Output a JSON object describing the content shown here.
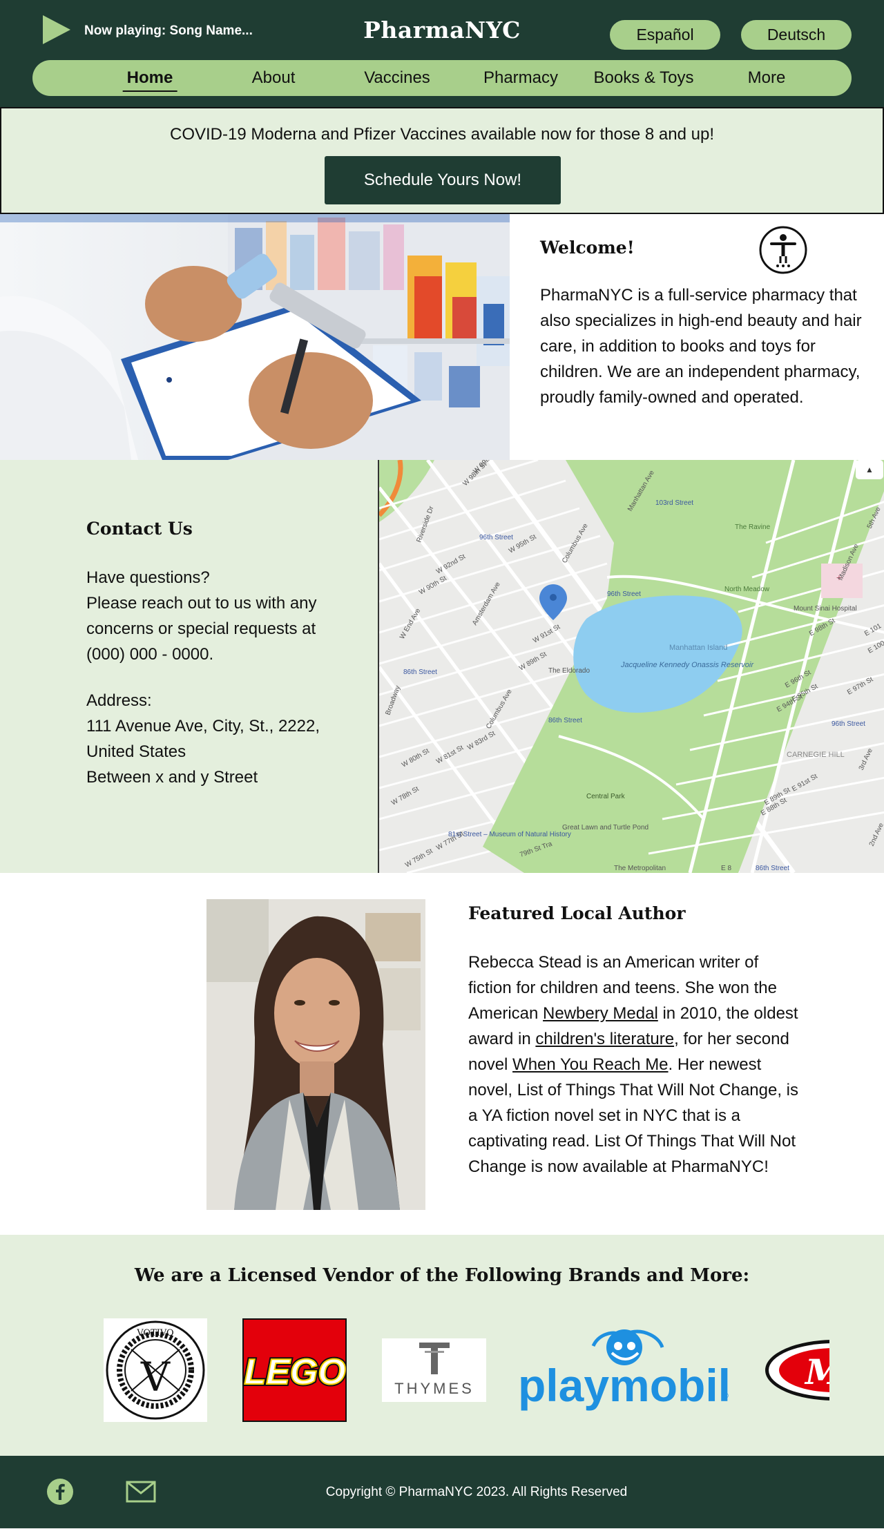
{
  "header": {
    "now_playing": "Now playing: Song Name...",
    "brand": "PharmaNYC",
    "languages": [
      "Español",
      "Deutsch"
    ],
    "nav": [
      "Home",
      "About",
      "Vaccines",
      "Pharmacy",
      "Books & Toys",
      "More"
    ],
    "active_nav": "Home"
  },
  "banner": {
    "text": "COVID-19 Moderna and Pfizer Vaccines available now for those 8 and up!",
    "button": "Schedule Yours Now!"
  },
  "welcome": {
    "title": "Welcome!",
    "text": "PharmaNYC is a full-service pharmacy that also specializes in high-end beauty and hair care, in addition to books and toys for children. We are an independent pharmacy, proudly family-owned and operated."
  },
  "contact": {
    "title": "Contact Us",
    "question": "Have questions?",
    "text": "Please reach out to us with any concerns or special requests at (000) 000 - 0000.",
    "address_label": "Address:",
    "address_line": "111 Avenue Ave, City, St., 2222, United States",
    "address_cross": "Between x and y Street"
  },
  "map": {
    "labels": {
      "w99": "W 99th St",
      "w98": "W 98th St",
      "manhattan_ave": "Manhattan Ave",
      "st103": "103rd Street",
      "fifth_ave": "5th Ave",
      "the_ravine": "The Ravine",
      "riverside": "Riverside Dr",
      "st96a": "96th Street",
      "w95": "W 95th St",
      "columbus_ave": "Columbus Ave",
      "w92": "W 92nd St",
      "w90": "W 90th St",
      "amsterdam": "Amsterdam Ave",
      "st96b": "96th Street",
      "north_meadow": "North Meadow",
      "madison": "Madison Ave",
      "mount_sinai": "Mount Sinai Hospital",
      "e98": "E 98th St",
      "e101": "E 101",
      "e100": "E 100",
      "w_end": "W End Ave",
      "w91": "W 91st St",
      "manhattan_island": "Manhattan Island",
      "st86a": "86th Street",
      "w89": "W 89th St",
      "eldorado": "The Eldorado",
      "broadway": "Broadway",
      "reservoir": "Jacqueline Kennedy Onassis Reservoir",
      "st86b": "86th Street",
      "columbus_ave2": "Columbus Ave",
      "e96": "E 96th St",
      "e97": "E 97th St",
      "e95": "E 95th St",
      "e94": "E 94th St",
      "st96c": "96th Street",
      "w83": "W 83rd St",
      "w80": "W 80th St",
      "w81": "W 81st St",
      "carnegie": "CARNEGIE HILL",
      "third_ave": "3rd Ave",
      "e91": "E 91st St",
      "e89": "E 89th St",
      "e88": "E 88th St",
      "central_park": "Central Park",
      "w78": "W 78th St",
      "museum": "81st Street – Museum of Natural History",
      "great_lawn": "Great Lawn and Turtle Pond",
      "second_ave": "2nd Ave",
      "w77": "W 77th St",
      "w75": "W 75th St",
      "w79": "79th St Tra",
      "metropolitan": "The Metropolitan",
      "e8": "E 8",
      "st86c": "86th Street"
    }
  },
  "author": {
    "title": "Featured Local Author",
    "p1": "Rebecca Stead is an American writer of fiction for children and teens. She won the American ",
    "link1": "Newbery Medal",
    "p2": " in 2010, the oldest award in ",
    "link2": "children's literature",
    "p3": ", for her second novel ",
    "link3": "When You Reach Me",
    "p4": ".  Her newest novel, List of Things That Will Not Change, is a YA fiction novel set in NYC that is a captivating read.  List Of Things That Will Not Change is now available at PharmaNYC!"
  },
  "vendors": {
    "title": "We are a Licensed Vendor of the Following Brands and More:",
    "logos": {
      "votivo": "VOTIVO",
      "votivo_letter": "V",
      "lego": "LEGO",
      "thymes": "THYMES",
      "playmobil": "playmobil",
      "playmobil_reg": "®",
      "melissa": "M"
    }
  },
  "footer": {
    "copyright": "Copyright © PharmaNYC 2023. All Rights Reserved"
  },
  "colors": {
    "dark_green": "#1f3d33",
    "light_green": "#a8cf8b",
    "pale_green": "#e4efdd"
  }
}
